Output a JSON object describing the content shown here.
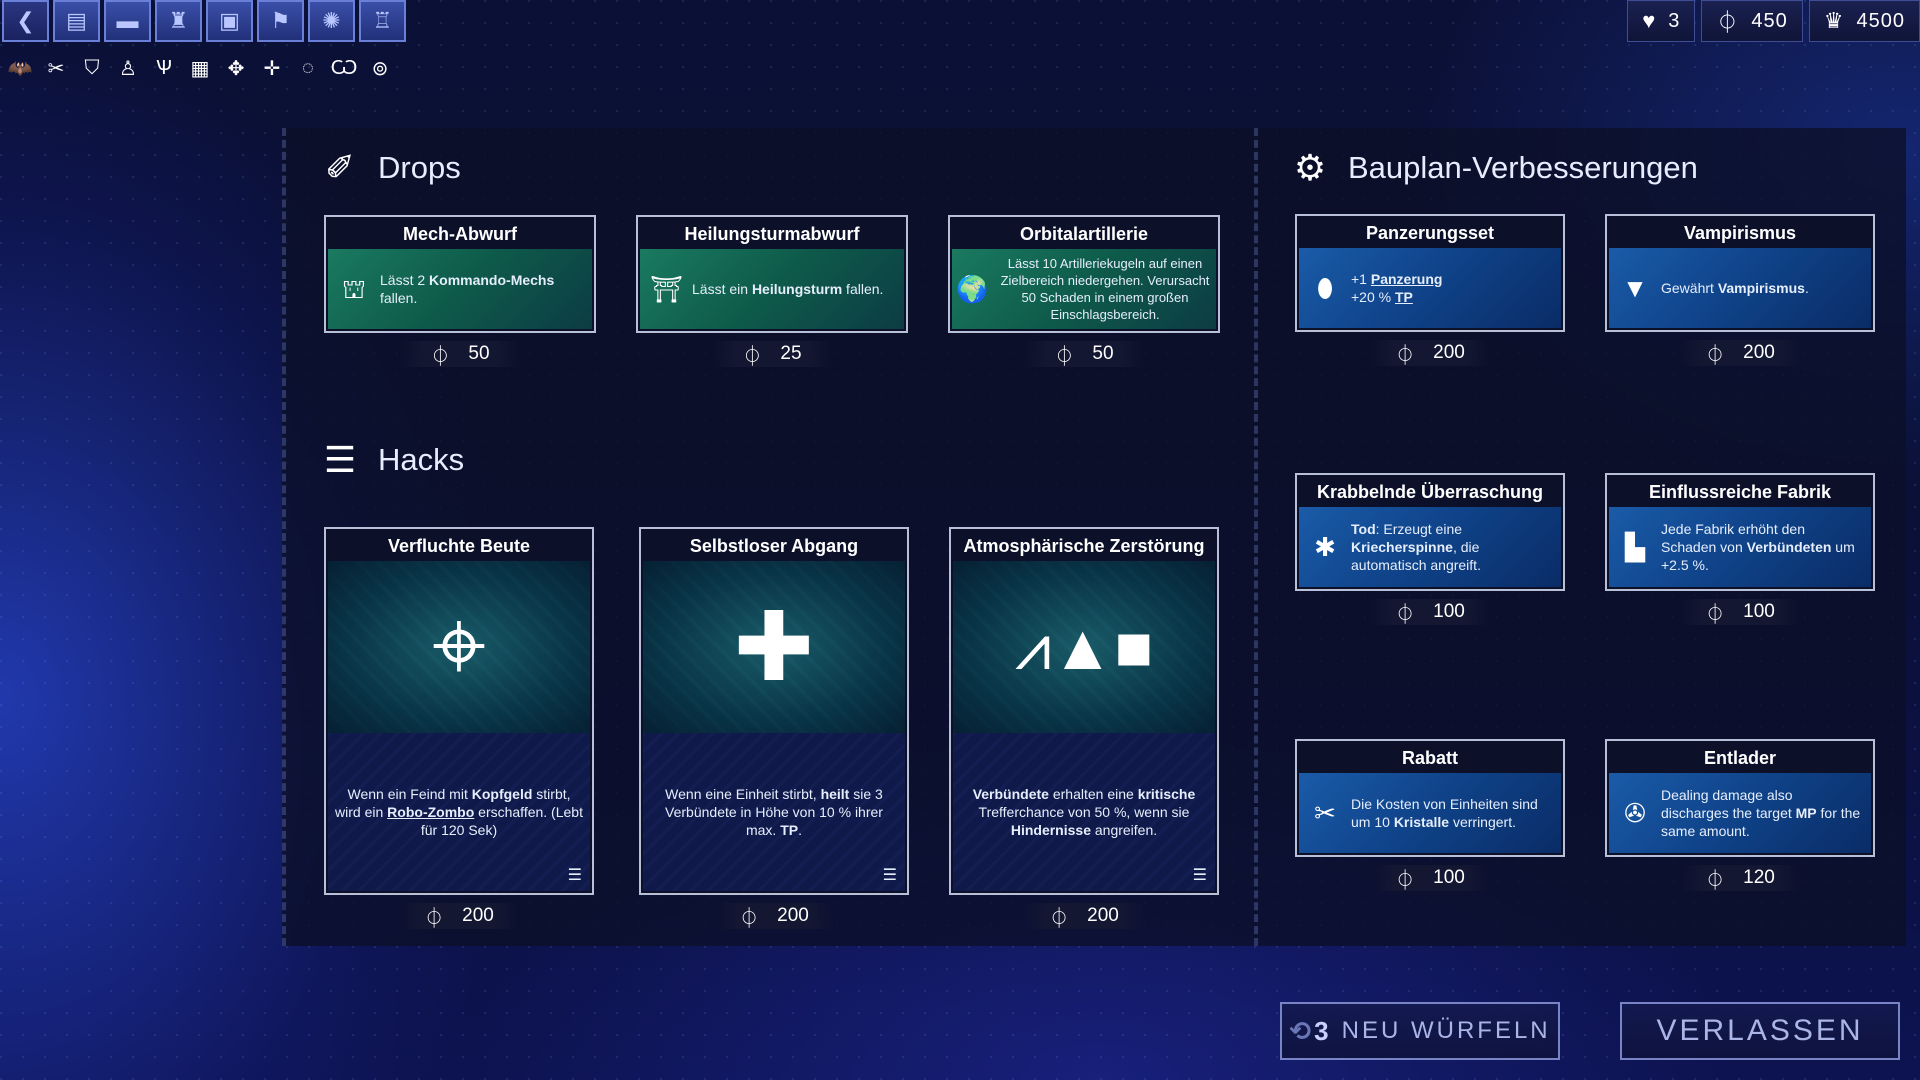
{
  "toolbar": {
    "buttons": [
      {
        "name": "back-button",
        "icon": "chevron-left-icon",
        "glyph": "❮"
      },
      {
        "name": "deck-button",
        "icon": "deck-icon",
        "glyph": "▤"
      },
      {
        "name": "unit-button",
        "icon": "drone-icon",
        "glyph": "▬"
      },
      {
        "name": "tower-button",
        "icon": "tower-icon",
        "glyph": "♜"
      },
      {
        "name": "factory-button",
        "icon": "factory-icon",
        "glyph": "▣"
      },
      {
        "name": "flag-button",
        "icon": "banner-icon",
        "glyph": "⚑"
      },
      {
        "name": "gear-button",
        "icon": "gear-icon",
        "glyph": "✺"
      },
      {
        "name": "fortress-button",
        "icon": "fortress-icon",
        "glyph": "♖"
      }
    ],
    "modifiers": [
      "bat-icon",
      "tools-icon",
      "shield-icon",
      "hierarchy-icon",
      "wings-icon",
      "crate-icon",
      "cross-arrows-icon",
      "plus-arrows-icon",
      "radial-icon",
      "fan-icon",
      "target-icon"
    ]
  },
  "resources": {
    "lives": "3",
    "crystals": "450",
    "score": "4500"
  },
  "drops": {
    "title": "Drops",
    "cards": [
      {
        "title": "Mech-Abwurf",
        "icon": "mech-icon",
        "pre": "Lässt 2 ",
        "link": "Kommando-Mechs",
        "post": " fallen.",
        "price": "50"
      },
      {
        "title": "Heilungsturmabwurf",
        "icon": "tower-icon",
        "pre": "Lässt ein ",
        "link": "Heilungsturm",
        "post": " fallen.",
        "price": "25"
      },
      {
        "title": "Orbitalartillerie",
        "icon": "planet-icon",
        "text": "Lässt 10 Artilleriekugeln auf einen Zielbereich niedergehen. Verursacht 50 Schaden in einem großen Einschlagsbereich.",
        "price": "50"
      }
    ]
  },
  "hacks": {
    "title": "Hacks",
    "cards": [
      {
        "title": "Verfluchte Beute",
        "a1": "Wenn ein Feind mit ",
        "b1": "Kopfgeld",
        "a2": " stirbt, wird ein ",
        "u1": "Robo-Zombo",
        "a3": " erschaffen. (Lebt für 120 Sek)",
        "price": "200"
      },
      {
        "title": "Selbstloser Abgang",
        "a1": "Wenn eine Einheit stirbt, ",
        "b1": "heilt",
        "a2": " sie 3 Verbündete in Höhe von 10 % ihrer max. ",
        "u1": "TP",
        "a3": ".",
        "price": "200"
      },
      {
        "title": "Atmosphärische Zerstörung",
        "b0": "Verbündete",
        "a1": " erhalten eine ",
        "b1": "kritische",
        "a2": " Trefferchance von 50 %, wenn sie ",
        "u1": "Hindernisse",
        "a3": " angreifen.",
        "price": "200"
      }
    ]
  },
  "blueprints": {
    "title": "Bauplan-Verbesserungen",
    "cards": [
      {
        "title": "Panzerungsset",
        "l1a": "+1 ",
        "l1b": "Panzerung",
        "l2a": "+20 % ",
        "l2b": "TP",
        "price": "200"
      },
      {
        "title": "Vampirismus",
        "pre": "Gewährt ",
        "link": "Vampirismus",
        "post": ".",
        "price": "200"
      },
      {
        "title": "Krabbelnde Überraschung",
        "b0": "Tod",
        "a1": ": Erzeugt eine ",
        "link": "Kriecherspinne",
        "a2": ", die automatisch angreift.",
        "price": "100"
      },
      {
        "title": "Einflussreiche Fabrik",
        "a1": "Jede Fabrik erhöht den Schaden von ",
        "link": "Verbündeten",
        "a2": " um +2.5 %.",
        "price": "100"
      },
      {
        "title": "Rabatt",
        "a1": "Die Kosten von Einheiten sind um 10 ",
        "link": "Kristalle",
        "a2": " verringert.",
        "price": "100"
      },
      {
        "title": "Entlader",
        "a1": "Dealing damage also discharges the target ",
        "link": "MP",
        "a2": " for the same amount.",
        "price": "120"
      }
    ]
  },
  "buttons": {
    "reroll_count": "3",
    "reroll": "NEU WÜRFELN",
    "leave": "VERLASSEN"
  }
}
